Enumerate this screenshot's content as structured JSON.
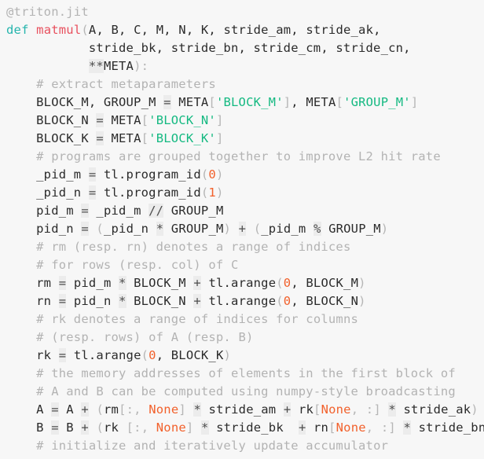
{
  "editor": {
    "background_color": "#f7f7f7",
    "language": "python",
    "font_size_px": 15.5,
    "line_height_px": 23,
    "colors": {
      "plain": "#2b2b2b",
      "comment": "#b3b3b3",
      "keyword": "#26b5ad",
      "function": "#e8505e",
      "string": "#14b981",
      "number": "#f2612c",
      "none_literal": "#f2612c",
      "punctuation": "#b6b6b6",
      "operator_text": "#4d4d4d",
      "operator_background": "#ececec"
    }
  },
  "code": {
    "lines": [
      {
        "index": 1,
        "text": "@triton.jit",
        "tokens": [
          {
            "t": "@triton.jit",
            "c": "comment"
          }
        ]
      },
      {
        "index": 2,
        "text": "def matmul(A, B, C, M, N, K, stride_am, stride_ak,",
        "tokens": [
          {
            "t": "def",
            "c": "keyword"
          },
          {
            "t": " ",
            "c": "plain"
          },
          {
            "t": "matmul",
            "c": "func"
          },
          {
            "t": "(",
            "c": "punct"
          },
          {
            "t": "A, B, C, M, N, K, stride_am, stride_ak,",
            "c": "plain"
          }
        ]
      },
      {
        "index": 3,
        "text": "           stride_bk, stride_bn, stride_cm, stride_cn,",
        "tokens": [
          {
            "t": "           stride_bk, stride_bn, stride_cm, stride_cn,",
            "c": "plain"
          }
        ]
      },
      {
        "index": 4,
        "text": "           **META):",
        "tokens": [
          {
            "t": "           ",
            "c": "plain"
          },
          {
            "t": "**",
            "c": "op"
          },
          {
            "t": "META",
            "c": "plain"
          },
          {
            "t": ")",
            "c": "punct"
          },
          {
            "t": ":",
            "c": "punct"
          }
        ]
      },
      {
        "index": 5,
        "text": "    # extract metaparameters",
        "tokens": [
          {
            "t": "    ",
            "c": "plain"
          },
          {
            "t": "# extract metaparameters",
            "c": "comment"
          }
        ]
      },
      {
        "index": 6,
        "text": "    BLOCK_M, GROUP_M = META['BLOCK_M'], META['GROUP_M']",
        "tokens": [
          {
            "t": "    BLOCK_M, GROUP_M ",
            "c": "plain"
          },
          {
            "t": "=",
            "c": "op"
          },
          {
            "t": " META",
            "c": "plain"
          },
          {
            "t": "[",
            "c": "punct"
          },
          {
            "t": "'BLOCK_M'",
            "c": "string"
          },
          {
            "t": "]",
            "c": "punct"
          },
          {
            "t": ", META",
            "c": "plain"
          },
          {
            "t": "[",
            "c": "punct"
          },
          {
            "t": "'GROUP_M'",
            "c": "string"
          },
          {
            "t": "]",
            "c": "punct"
          }
        ]
      },
      {
        "index": 7,
        "text": "    BLOCK_N = META['BLOCK_N']",
        "tokens": [
          {
            "t": "    BLOCK_N ",
            "c": "plain"
          },
          {
            "t": "=",
            "c": "op"
          },
          {
            "t": " META",
            "c": "plain"
          },
          {
            "t": "[",
            "c": "punct"
          },
          {
            "t": "'BLOCK_N'",
            "c": "string"
          },
          {
            "t": "]",
            "c": "punct"
          }
        ]
      },
      {
        "index": 8,
        "text": "    BLOCK_K = META['BLOCK_K']",
        "tokens": [
          {
            "t": "    BLOCK_K ",
            "c": "plain"
          },
          {
            "t": "=",
            "c": "op"
          },
          {
            "t": " META",
            "c": "plain"
          },
          {
            "t": "[",
            "c": "punct"
          },
          {
            "t": "'BLOCK_K'",
            "c": "string"
          },
          {
            "t": "]",
            "c": "punct"
          }
        ]
      },
      {
        "index": 9,
        "text": "    # programs are grouped together to improve L2 hit rate",
        "tokens": [
          {
            "t": "    ",
            "c": "plain"
          },
          {
            "t": "# programs are grouped together to improve L2 hit rate",
            "c": "comment"
          }
        ]
      },
      {
        "index": 10,
        "text": "    _pid_m = tl.program_id(0)",
        "tokens": [
          {
            "t": "    _pid_m ",
            "c": "plain"
          },
          {
            "t": "=",
            "c": "op"
          },
          {
            "t": " tl.program_id",
            "c": "plain"
          },
          {
            "t": "(",
            "c": "punct"
          },
          {
            "t": "0",
            "c": "number"
          },
          {
            "t": ")",
            "c": "punct"
          }
        ]
      },
      {
        "index": 11,
        "text": "    _pid_n = tl.program_id(1)",
        "tokens": [
          {
            "t": "    _pid_n ",
            "c": "plain"
          },
          {
            "t": "=",
            "c": "op"
          },
          {
            "t": " tl.program_id",
            "c": "plain"
          },
          {
            "t": "(",
            "c": "punct"
          },
          {
            "t": "1",
            "c": "number"
          },
          {
            "t": ")",
            "c": "punct"
          }
        ]
      },
      {
        "index": 12,
        "text": "    pid_m = _pid_m // GROUP_M",
        "tokens": [
          {
            "t": "    pid_m ",
            "c": "plain"
          },
          {
            "t": "=",
            "c": "op"
          },
          {
            "t": " _pid_m ",
            "c": "plain"
          },
          {
            "t": "//",
            "c": "op"
          },
          {
            "t": " GROUP_M",
            "c": "plain"
          }
        ]
      },
      {
        "index": 13,
        "text": "    pid_n = (_pid_n * GROUP_M) + (_pid_m % GROUP_M)",
        "tokens": [
          {
            "t": "    pid_n ",
            "c": "plain"
          },
          {
            "t": "=",
            "c": "op"
          },
          {
            "t": " ",
            "c": "plain"
          },
          {
            "t": "(",
            "c": "punct"
          },
          {
            "t": "_pid_n ",
            "c": "plain"
          },
          {
            "t": "*",
            "c": "op"
          },
          {
            "t": " GROUP_M",
            "c": "plain"
          },
          {
            "t": ")",
            "c": "punct"
          },
          {
            "t": " ",
            "c": "plain"
          },
          {
            "t": "+",
            "c": "op"
          },
          {
            "t": " ",
            "c": "plain"
          },
          {
            "t": "(",
            "c": "punct"
          },
          {
            "t": "_pid_m ",
            "c": "plain"
          },
          {
            "t": "%",
            "c": "op"
          },
          {
            "t": " GROUP_M",
            "c": "plain"
          },
          {
            "t": ")",
            "c": "punct"
          }
        ]
      },
      {
        "index": 14,
        "text": "    # rm (resp. rn) denotes a range of indices",
        "tokens": [
          {
            "t": "    ",
            "c": "plain"
          },
          {
            "t": "# rm (resp. rn) denotes a range of indices",
            "c": "comment"
          }
        ]
      },
      {
        "index": 15,
        "text": "    # for rows (resp. col) of C",
        "tokens": [
          {
            "t": "    ",
            "c": "plain"
          },
          {
            "t": "# for rows (resp. col) of C",
            "c": "comment"
          }
        ]
      },
      {
        "index": 16,
        "text": "    rm = pid_m * BLOCK_M + tl.arange(0, BLOCK_M)",
        "tokens": [
          {
            "t": "    rm ",
            "c": "plain"
          },
          {
            "t": "=",
            "c": "op"
          },
          {
            "t": " pid_m ",
            "c": "plain"
          },
          {
            "t": "*",
            "c": "op"
          },
          {
            "t": " BLOCK_M ",
            "c": "plain"
          },
          {
            "t": "+",
            "c": "op"
          },
          {
            "t": " tl.arange",
            "c": "plain"
          },
          {
            "t": "(",
            "c": "punct"
          },
          {
            "t": "0",
            "c": "number"
          },
          {
            "t": ", BLOCK_M",
            "c": "plain"
          },
          {
            "t": ")",
            "c": "punct"
          }
        ]
      },
      {
        "index": 17,
        "text": "    rn = pid_n * BLOCK_N + tl.arange(0, BLOCK_N)",
        "tokens": [
          {
            "t": "    rn ",
            "c": "plain"
          },
          {
            "t": "=",
            "c": "op"
          },
          {
            "t": " pid_n ",
            "c": "plain"
          },
          {
            "t": "*",
            "c": "op"
          },
          {
            "t": " BLOCK_N ",
            "c": "plain"
          },
          {
            "t": "+",
            "c": "op"
          },
          {
            "t": " tl.arange",
            "c": "plain"
          },
          {
            "t": "(",
            "c": "punct"
          },
          {
            "t": "0",
            "c": "number"
          },
          {
            "t": ", BLOCK_N",
            "c": "plain"
          },
          {
            "t": ")",
            "c": "punct"
          }
        ]
      },
      {
        "index": 18,
        "text": "    # rk denotes a range of indices for columns",
        "tokens": [
          {
            "t": "    ",
            "c": "plain"
          },
          {
            "t": "# rk denotes a range of indices for columns",
            "c": "comment"
          }
        ]
      },
      {
        "index": 19,
        "text": "    # (resp. rows) of A (resp. B)",
        "tokens": [
          {
            "t": "    ",
            "c": "plain"
          },
          {
            "t": "# (resp. rows) of A (resp. B)",
            "c": "comment"
          }
        ]
      },
      {
        "index": 20,
        "text": "    rk = tl.arange(0, BLOCK_K)",
        "tokens": [
          {
            "t": "    rk ",
            "c": "plain"
          },
          {
            "t": "=",
            "c": "op"
          },
          {
            "t": " tl.arange",
            "c": "plain"
          },
          {
            "t": "(",
            "c": "punct"
          },
          {
            "t": "0",
            "c": "number"
          },
          {
            "t": ", BLOCK_K",
            "c": "plain"
          },
          {
            "t": ")",
            "c": "punct"
          }
        ]
      },
      {
        "index": 21,
        "text": "    # the memory addresses of elements in the first block of",
        "tokens": [
          {
            "t": "    ",
            "c": "plain"
          },
          {
            "t": "# the memory addresses of elements in the first block of",
            "c": "comment"
          }
        ]
      },
      {
        "index": 22,
        "text": "    # A and B can be computed using numpy-style broadcasting",
        "tokens": [
          {
            "t": "    ",
            "c": "plain"
          },
          {
            "t": "# A and B can be computed using numpy-style broadcasting",
            "c": "comment"
          }
        ]
      },
      {
        "index": 23,
        "text": "    A = A + (rm[:, None] * stride_am + rk[None, :] * stride_ak)",
        "tokens": [
          {
            "t": "    A ",
            "c": "plain"
          },
          {
            "t": "=",
            "c": "op"
          },
          {
            "t": " A ",
            "c": "plain"
          },
          {
            "t": "+",
            "c": "op"
          },
          {
            "t": " ",
            "c": "plain"
          },
          {
            "t": "(",
            "c": "punct"
          },
          {
            "t": "rm",
            "c": "plain"
          },
          {
            "t": "[",
            "c": "punct"
          },
          {
            "t": ":, ",
            "c": "punct"
          },
          {
            "t": "None",
            "c": "none"
          },
          {
            "t": "]",
            "c": "punct"
          },
          {
            "t": " ",
            "c": "plain"
          },
          {
            "t": "*",
            "c": "op"
          },
          {
            "t": " stride_am ",
            "c": "plain"
          },
          {
            "t": "+",
            "c": "op"
          },
          {
            "t": " rk",
            "c": "plain"
          },
          {
            "t": "[",
            "c": "punct"
          },
          {
            "t": "None",
            "c": "none"
          },
          {
            "t": ", :",
            "c": "punct"
          },
          {
            "t": "]",
            "c": "punct"
          },
          {
            "t": " ",
            "c": "plain"
          },
          {
            "t": "*",
            "c": "op"
          },
          {
            "t": " stride_ak",
            "c": "plain"
          },
          {
            "t": ")",
            "c": "punct"
          }
        ]
      },
      {
        "index": 24,
        "text": "    B = B + (rk [:, None] * stride_bk  + rn[None, :] * stride_bn)",
        "tokens": [
          {
            "t": "    B ",
            "c": "plain"
          },
          {
            "t": "=",
            "c": "op"
          },
          {
            "t": " B ",
            "c": "plain"
          },
          {
            "t": "+",
            "c": "op"
          },
          {
            "t": " ",
            "c": "plain"
          },
          {
            "t": "(",
            "c": "punct"
          },
          {
            "t": "rk ",
            "c": "plain"
          },
          {
            "t": "[",
            "c": "punct"
          },
          {
            "t": ":, ",
            "c": "punct"
          },
          {
            "t": "None",
            "c": "none"
          },
          {
            "t": "]",
            "c": "punct"
          },
          {
            "t": " ",
            "c": "plain"
          },
          {
            "t": "*",
            "c": "op"
          },
          {
            "t": " stride_bk  ",
            "c": "plain"
          },
          {
            "t": "+",
            "c": "op"
          },
          {
            "t": " rn",
            "c": "plain"
          },
          {
            "t": "[",
            "c": "punct"
          },
          {
            "t": "None",
            "c": "none"
          },
          {
            "t": ", :",
            "c": "punct"
          },
          {
            "t": "]",
            "c": "punct"
          },
          {
            "t": " ",
            "c": "plain"
          },
          {
            "t": "*",
            "c": "op"
          },
          {
            "t": " stride_bn",
            "c": "plain"
          },
          {
            "t": ")",
            "c": "punct"
          }
        ]
      },
      {
        "index": 25,
        "text": "    # initialize and iteratively update accumulator",
        "tokens": [
          {
            "t": "    ",
            "c": "plain"
          },
          {
            "t": "# initialize and iteratively update accumulator",
            "c": "comment"
          }
        ]
      }
    ]
  }
}
